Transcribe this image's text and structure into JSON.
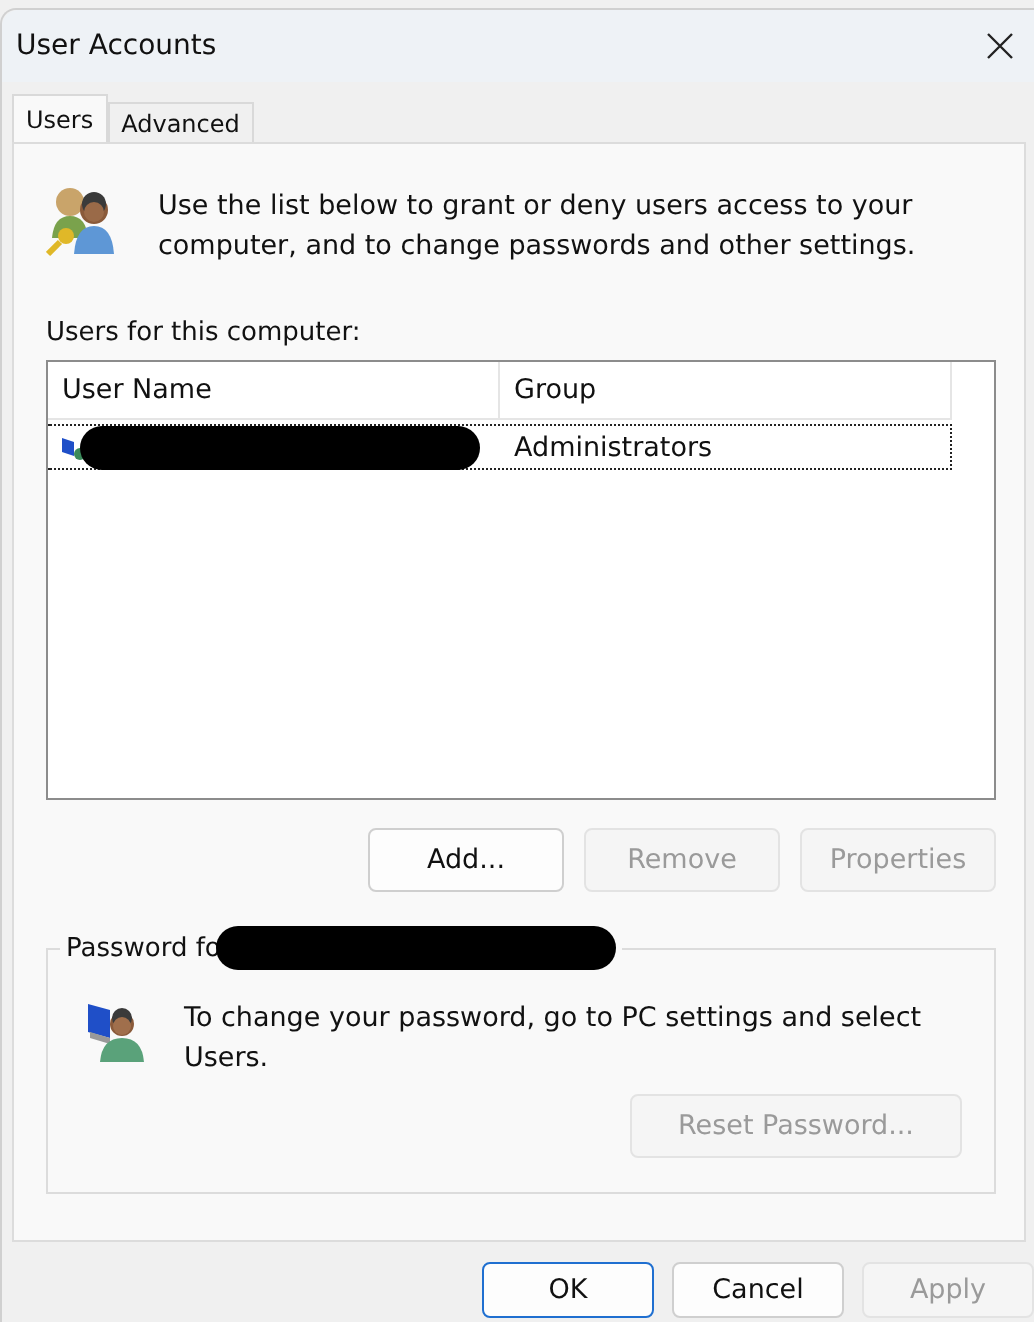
{
  "window": {
    "title": "User Accounts"
  },
  "tabs": [
    {
      "label": "Users",
      "selected": true
    },
    {
      "label": "Advanced",
      "selected": false
    }
  ],
  "intro": "Use the list below to grant or deny users access to your computer, and to change passwords and other settings.",
  "users_list": {
    "label": "Users for this computer:",
    "columns": [
      "User Name",
      "Group"
    ],
    "rows": [
      {
        "user_name_redacted": true,
        "group": "Administrators",
        "selected": true
      }
    ]
  },
  "list_buttons": [
    {
      "label": "Add...",
      "disabled": false
    },
    {
      "label": "Remove",
      "disabled": true
    },
    {
      "label": "Properties",
      "disabled": true
    }
  ],
  "password_group": {
    "legend": "Password fo",
    "legend_redacted": true,
    "text": "To change your password, go to PC settings and select Users.",
    "button": {
      "label": "Reset Password...",
      "disabled": true
    }
  },
  "dialog_buttons": [
    {
      "label": "OK",
      "default": true,
      "disabled": false
    },
    {
      "label": "Cancel",
      "default": false,
      "disabled": false
    },
    {
      "label": "Apply",
      "default": false,
      "disabled": true
    }
  ]
}
